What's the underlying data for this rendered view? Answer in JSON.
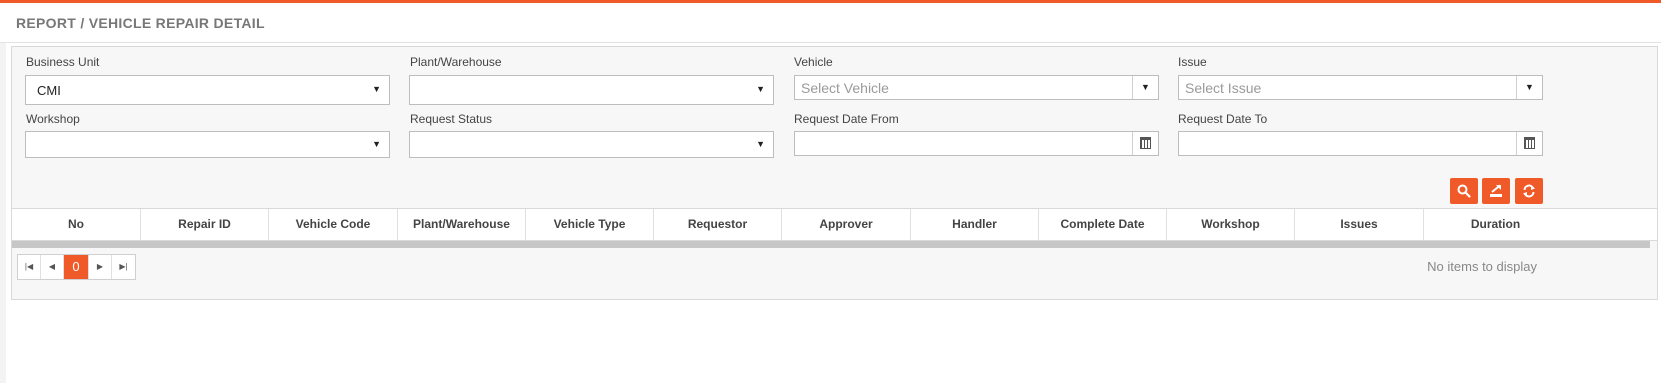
{
  "page": {
    "title": "REPORT / VEHICLE REPAIR DETAIL"
  },
  "accent_color": "#f05a28",
  "filters": {
    "business_unit": {
      "label": "Business Unit",
      "value": "CMI"
    },
    "plant": {
      "label": "Plant/Warehouse",
      "value": ""
    },
    "vehicle": {
      "label": "Vehicle",
      "placeholder": "Select Vehicle"
    },
    "issue": {
      "label": "Issue",
      "placeholder": "Select Issue"
    },
    "workshop": {
      "label": "Workshop",
      "value": ""
    },
    "request_status": {
      "label": "Request Status",
      "value": ""
    },
    "date_from": {
      "label": "Request Date From",
      "value": ""
    },
    "date_to": {
      "label": "Request Date To",
      "value": ""
    }
  },
  "actions": {
    "search_icon": "search-icon",
    "export_icon": "export-icon",
    "refresh_icon": "refresh-icon"
  },
  "grid": {
    "columns": [
      "No",
      "Repair ID",
      "Vehicle Code",
      "Plant/Warehouse",
      "Vehicle Type",
      "Requestor",
      "Approver",
      "Handler",
      "Complete Date",
      "Workshop",
      "Issues",
      "Duration"
    ],
    "rows": []
  },
  "pager": {
    "current_page": "0",
    "status": "No items to display"
  }
}
